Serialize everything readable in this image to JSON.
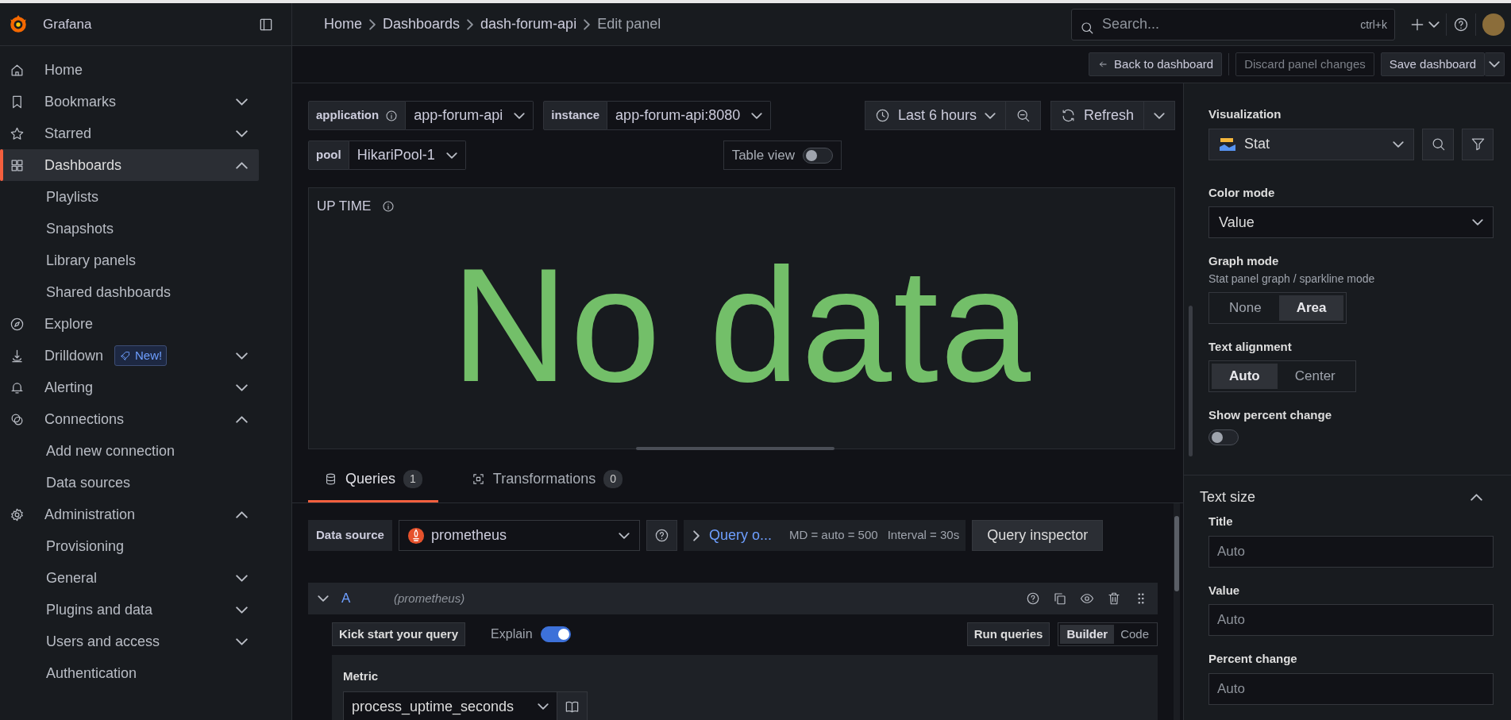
{
  "app": {
    "name": "Grafana"
  },
  "breadcrumbs": [
    {
      "label": "Home",
      "current": false
    },
    {
      "label": "Dashboards",
      "current": false
    },
    {
      "label": "dash-forum-api",
      "current": false
    },
    {
      "label": "Edit panel",
      "current": true
    }
  ],
  "search": {
    "placeholder": "Search...",
    "shortcut": "ctrl+k"
  },
  "sidebar": {
    "items": [
      {
        "label": "Home",
        "selected": false
      },
      {
        "label": "Bookmarks",
        "selected": false,
        "expanded": false
      },
      {
        "label": "Starred",
        "selected": false,
        "expanded": false
      },
      {
        "label": "Dashboards",
        "selected": true,
        "expanded": true,
        "children": [
          {
            "label": "Playlists",
            "selected": false
          },
          {
            "label": "Snapshots",
            "selected": false
          },
          {
            "label": "Library panels",
            "selected": false
          },
          {
            "label": "Shared dashboards",
            "selected": false
          }
        ]
      },
      {
        "label": "Explore",
        "selected": false
      },
      {
        "label": "Drilldown",
        "selected": false,
        "expanded": false,
        "badge": "New!"
      },
      {
        "label": "Alerting",
        "selected": false,
        "expanded": false
      },
      {
        "label": "Connections",
        "selected": false,
        "expanded": true,
        "children": [
          {
            "label": "Add new connection",
            "selected": false
          },
          {
            "label": "Data sources",
            "selected": false
          }
        ]
      },
      {
        "label": "Administration",
        "selected": false,
        "expanded": true,
        "children": [
          {
            "label": "Provisioning",
            "selected": false
          },
          {
            "label": "General",
            "selected": false,
            "expanded": false
          },
          {
            "label": "Plugins and data",
            "selected": false,
            "expanded": false
          },
          {
            "label": "Users and access",
            "selected": false,
            "expanded": false
          },
          {
            "label": "Authentication",
            "selected": false
          }
        ]
      }
    ]
  },
  "edit_actions": [
    {
      "label": "Back to dashboard",
      "kind": "back",
      "disabled": false
    },
    {
      "label": "Discard panel changes",
      "kind": "plain",
      "disabled": true
    },
    {
      "label": "Save dashboard",
      "kind": "split",
      "disabled": false
    }
  ],
  "variables": [
    {
      "label": "application",
      "info": true,
      "value": "app-forum-api"
    },
    {
      "label": "instance",
      "info": false,
      "value": "app-forum-api:8080"
    },
    {
      "label": "pool",
      "info": false,
      "value": "HikariPool-1"
    }
  ],
  "time_range": {
    "label": "Last 6 hours"
  },
  "refresh": {
    "label": "Refresh"
  },
  "table_view": {
    "label": "Table view",
    "on": false
  },
  "panel": {
    "title": "UP TIME",
    "value": "No data"
  },
  "editor_tabs": [
    {
      "label": "Queries",
      "count": "1",
      "selected": true
    },
    {
      "label": "Transformations",
      "count": "0",
      "selected": false
    }
  ],
  "query_toolbar": {
    "data_source_label": "Data source",
    "data_source": "prometheus",
    "options_label": "Query o...",
    "max_data_points": "MD = auto = 500",
    "interval": "Interval = 30s",
    "inspector": "Query inspector"
  },
  "query": {
    "ref": "A",
    "datasource": "(prometheus)",
    "expanded": true,
    "kick_start": "Kick start your query",
    "explain": {
      "label": "Explain",
      "on": true
    },
    "run": "Run queries",
    "modes": [
      {
        "label": "Builder",
        "selected": true
      },
      {
        "label": "Code",
        "selected": false
      }
    ],
    "metric_label": "Metric",
    "metric": "process_uptime_seconds"
  },
  "options": {
    "visualization_label": "Visualization",
    "visualization": "Stat",
    "color_mode_label": "Color mode",
    "color_mode": "Value",
    "graph_mode": {
      "label": "Graph mode",
      "description": "Stat panel graph / sparkline mode",
      "choices": [
        {
          "label": "None",
          "selected": false
        },
        {
          "label": "Area",
          "selected": true
        }
      ]
    },
    "text_alignment": {
      "label": "Text alignment",
      "choices": [
        {
          "label": "Auto",
          "selected": true
        },
        {
          "label": "Center",
          "selected": false
        }
      ]
    },
    "percent_change": {
      "label": "Show percent change",
      "on": false
    },
    "text_size": {
      "title": "Text size",
      "expanded": true,
      "fields": [
        {
          "label": "Title",
          "placeholder": "Auto"
        },
        {
          "label": "Value",
          "placeholder": "Auto"
        },
        {
          "label": "Percent change",
          "placeholder": "Auto"
        }
      ]
    }
  }
}
